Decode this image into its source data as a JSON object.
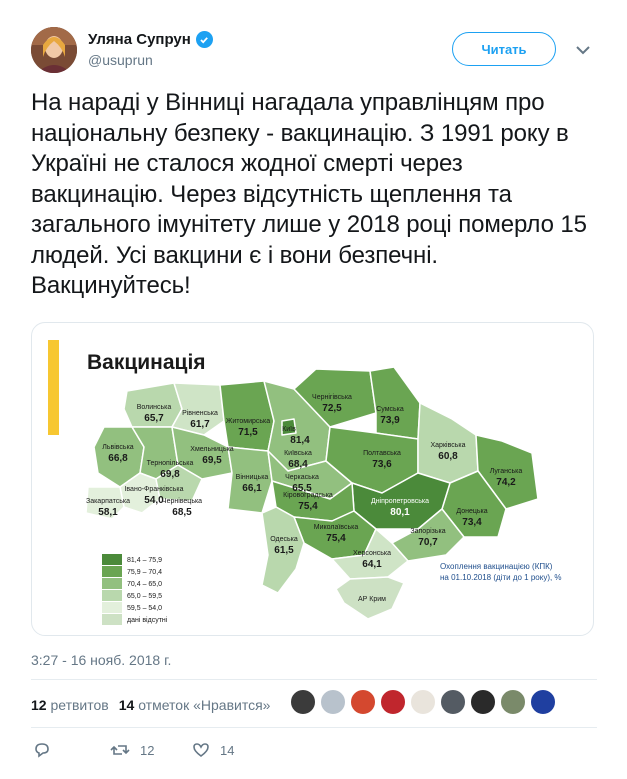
{
  "user": {
    "name": "Уляна Супрун",
    "handle": "@usuprun"
  },
  "follow_label": "Читать",
  "tweet_text": "На нараді у Вінниці нагадала управлінцям про національну безпеку - вакцинацію. З 1991 року в Україні не сталося жодної смерті через вакцинацію. Через відсутність щеплення та загального імунітету лише у 2018 році померло 15 людей. Усі вакцини є і вони безпечні. Вакцинуйтесь!",
  "map": {
    "title": "Вакцинація",
    "accent": "#f7c731",
    "regions": [
      {
        "name": "Волинська",
        "value": "65,7"
      },
      {
        "name": "Рівненська",
        "value": "61,7"
      },
      {
        "name": "Житомирська",
        "value": "71,5"
      },
      {
        "name": "Київ",
        "value": "81,4"
      },
      {
        "name": "Чернігівська",
        "value": "72,5"
      },
      {
        "name": "Сумська",
        "value": "73,9"
      },
      {
        "name": "Львівська",
        "value": "66,8"
      },
      {
        "name": "Хмельницька",
        "value": "69,5"
      },
      {
        "name": "Київська",
        "value": "68,4"
      },
      {
        "name": "Полтавська",
        "value": "73,6"
      },
      {
        "name": "Харківська",
        "value": "60,8"
      },
      {
        "name": "Луганська",
        "value": "74,2"
      },
      {
        "name": "Тернопільська",
        "value": "69,8"
      },
      {
        "name": "Черкаська",
        "value": "65,5"
      },
      {
        "name": "Вінницька",
        "value": "66,1"
      },
      {
        "name": "Івано-Франківська",
        "value": "54,0"
      },
      {
        "name": "Закарпатська",
        "value": "58,1"
      },
      {
        "name": "Чернівецька",
        "value": "68,5"
      },
      {
        "name": "Кіровоградська",
        "value": "75,4"
      },
      {
        "name": "Дніпропетровська",
        "value": "80,1"
      },
      {
        "name": "Донецька",
        "value": "73,4"
      },
      {
        "name": "Миколаївська",
        "value": "75,4"
      },
      {
        "name": "Запорізька",
        "value": "70,7"
      },
      {
        "name": "Одеська",
        "value": "61,5"
      },
      {
        "name": "Херсонська",
        "value": "64,1"
      },
      {
        "name": "АР Крим",
        "value": ""
      }
    ],
    "legend": [
      {
        "label": "81,4 – 75,9",
        "color": "#4b8a3a"
      },
      {
        "label": "75,9 – 70,4",
        "color": "#6aa552"
      },
      {
        "label": "70,4 – 65,0",
        "color": "#92c07f"
      },
      {
        "label": "65,0 – 59,5",
        "color": "#b9d8ad"
      },
      {
        "label": "59,5 – 54,0",
        "color": "#e3f0dc"
      },
      {
        "label": "дані відсутні",
        "color": "#cde1c4"
      }
    ],
    "caption_line1": "Охоплення вакцинацією (КПК)",
    "caption_line2": "на 01.10.2018 (діти до 1 року), %"
  },
  "timestamp": "3:27 - 16 нояб. 2018 г.",
  "stats": {
    "retweets_num": "12",
    "retweets_label": "ретвитов",
    "likes_num": "14",
    "likes_label": "отметок «Нравится»"
  },
  "actions": {
    "reply_count": "",
    "retweet_count": "12",
    "like_count": "14"
  },
  "colors": {
    "brand": "#1da1f2",
    "muted": "#657786"
  }
}
